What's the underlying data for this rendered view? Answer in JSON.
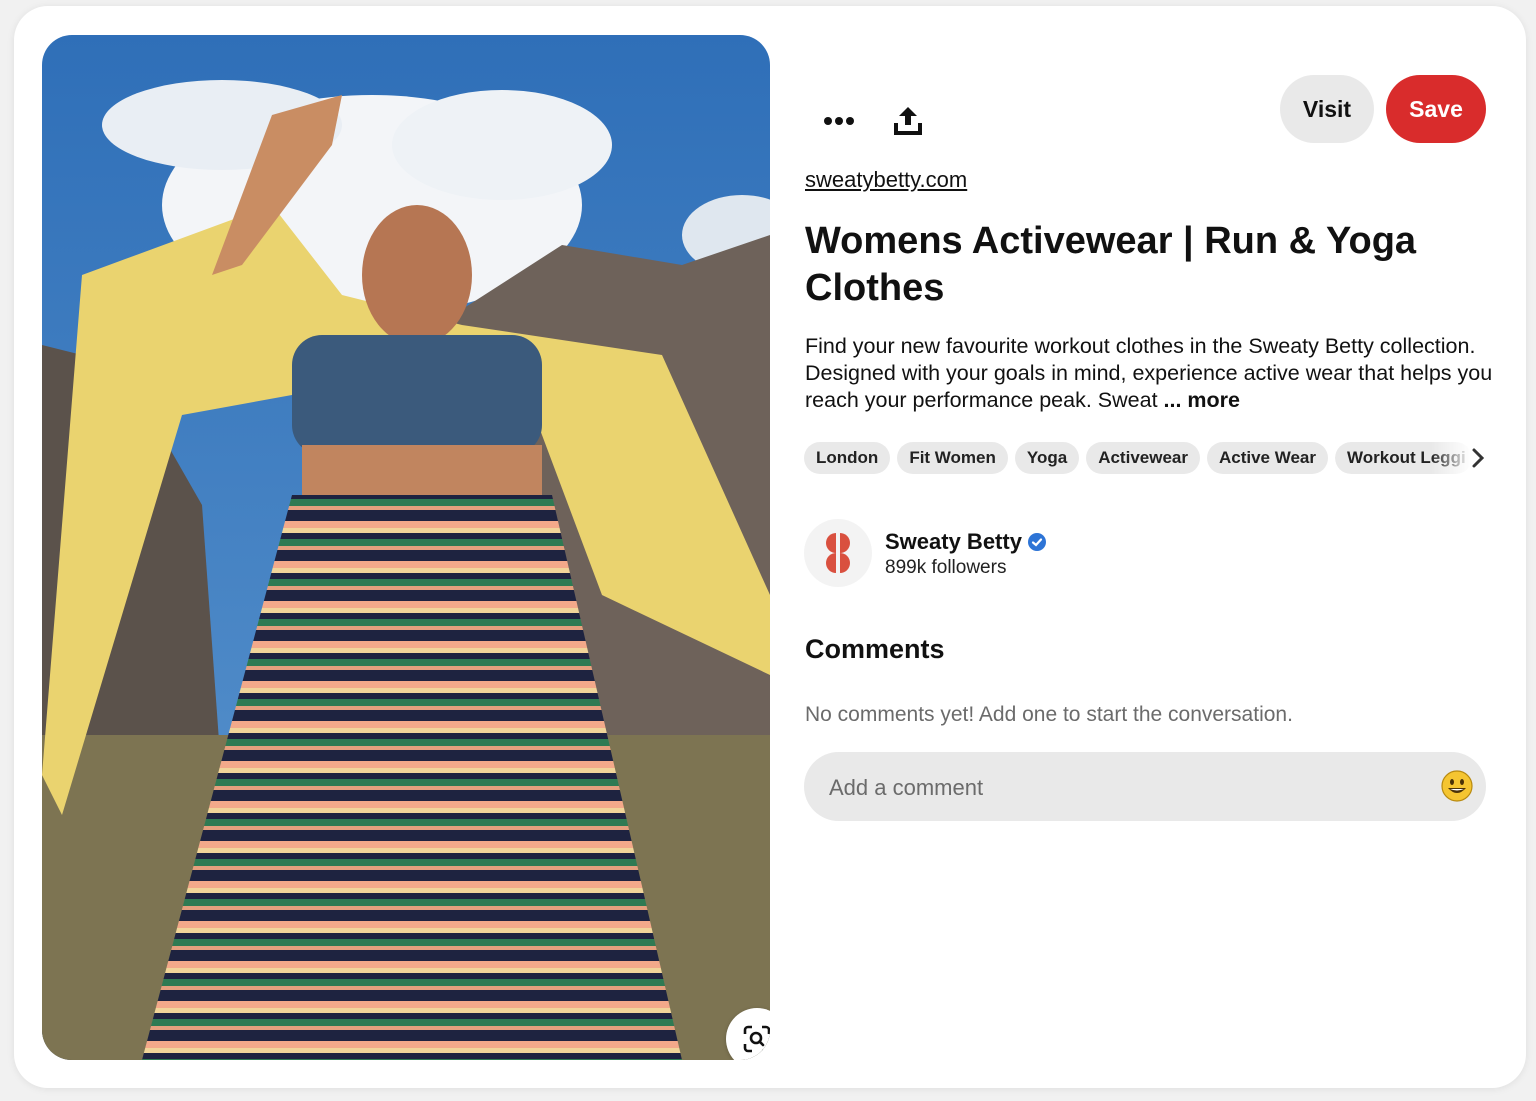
{
  "pin": {
    "source_link": "sweatybetty.com",
    "title": "Womens Activewear | Run & Yoga Clothes",
    "description": "Find your new favourite workout clothes in the Sweaty Betty collection. Designed with your goals in mind, experience active wear that helps you reach your performance peak. Sweat",
    "more_label": "... more",
    "image_icon": "visual-search-icon"
  },
  "toolbar": {
    "more_icon": "ellipsis-icon",
    "share_icon": "share-upload-icon",
    "visit_label": "Visit",
    "save_label": "Save",
    "save_color": "#d92c2c"
  },
  "tags": [
    "London",
    "Fit Women",
    "Yoga",
    "Activewear",
    "Active Wear",
    "Workout Leggi"
  ],
  "creator": {
    "name": "Sweaty Betty",
    "verified": true,
    "followers": "899k followers",
    "logo_color": "#d9503f"
  },
  "comments": {
    "heading": "Comments",
    "empty_text": "No comments yet! Add one to start the conversation.",
    "input_placeholder": "Add a comment",
    "emoji_icon": "smiley-emoji-icon"
  }
}
